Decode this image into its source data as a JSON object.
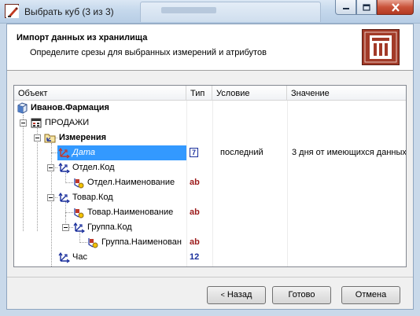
{
  "window": {
    "title": "Выбрать куб (3 из 3)"
  },
  "header": {
    "title": "Импорт данных из хранилища",
    "subtitle": "Определите срезы для выбранных измерений и атрибутов"
  },
  "grid": {
    "columns": [
      "Объект",
      "Тип",
      "Условие",
      "Значение"
    ],
    "rows": [
      {
        "label": "Иванов.Фармация",
        "type": "",
        "condition": "",
        "value": ""
      },
      {
        "label": "ПРОДАЖИ",
        "type": "",
        "condition": "",
        "value": ""
      },
      {
        "label": "Измерения",
        "type": "",
        "condition": "",
        "value": ""
      },
      {
        "label": "Дата",
        "type": "7",
        "condition": "последний",
        "value": "3 дня от имеющихся данных"
      },
      {
        "label": "Отдел.Код",
        "type": "",
        "condition": "",
        "value": ""
      },
      {
        "label": "Отдел.Наименование",
        "type": "ab",
        "condition": "",
        "value": ""
      },
      {
        "label": "Товар.Код",
        "type": "",
        "condition": "",
        "value": ""
      },
      {
        "label": "Товар.Наименование",
        "type": "ab",
        "condition": "",
        "value": ""
      },
      {
        "label": "Группа.Код",
        "type": "",
        "condition": "",
        "value": ""
      },
      {
        "label": "Группа.Наименован",
        "type": "ab",
        "condition": "",
        "value": ""
      },
      {
        "label": "Час",
        "type": "12",
        "condition": "",
        "value": ""
      }
    ]
  },
  "footer": {
    "back_label": "Назад",
    "back_arrow": "<",
    "done_label": "Готово",
    "cancel_label": "Отмена"
  },
  "colors": {
    "selection": "#3399ff",
    "brand": "#a23a28",
    "type_text": "#9c1b1b",
    "type_number": "#1a2f9c"
  },
  "icons": {
    "app": "cube-wizard-icon",
    "header": "data-warehouse-icon",
    "database": "database-icon",
    "cube": "cube-icon",
    "folder": "dimensions-folder-icon",
    "dimension": "dimension-axis-icon",
    "attribute": "attribute-icon"
  }
}
